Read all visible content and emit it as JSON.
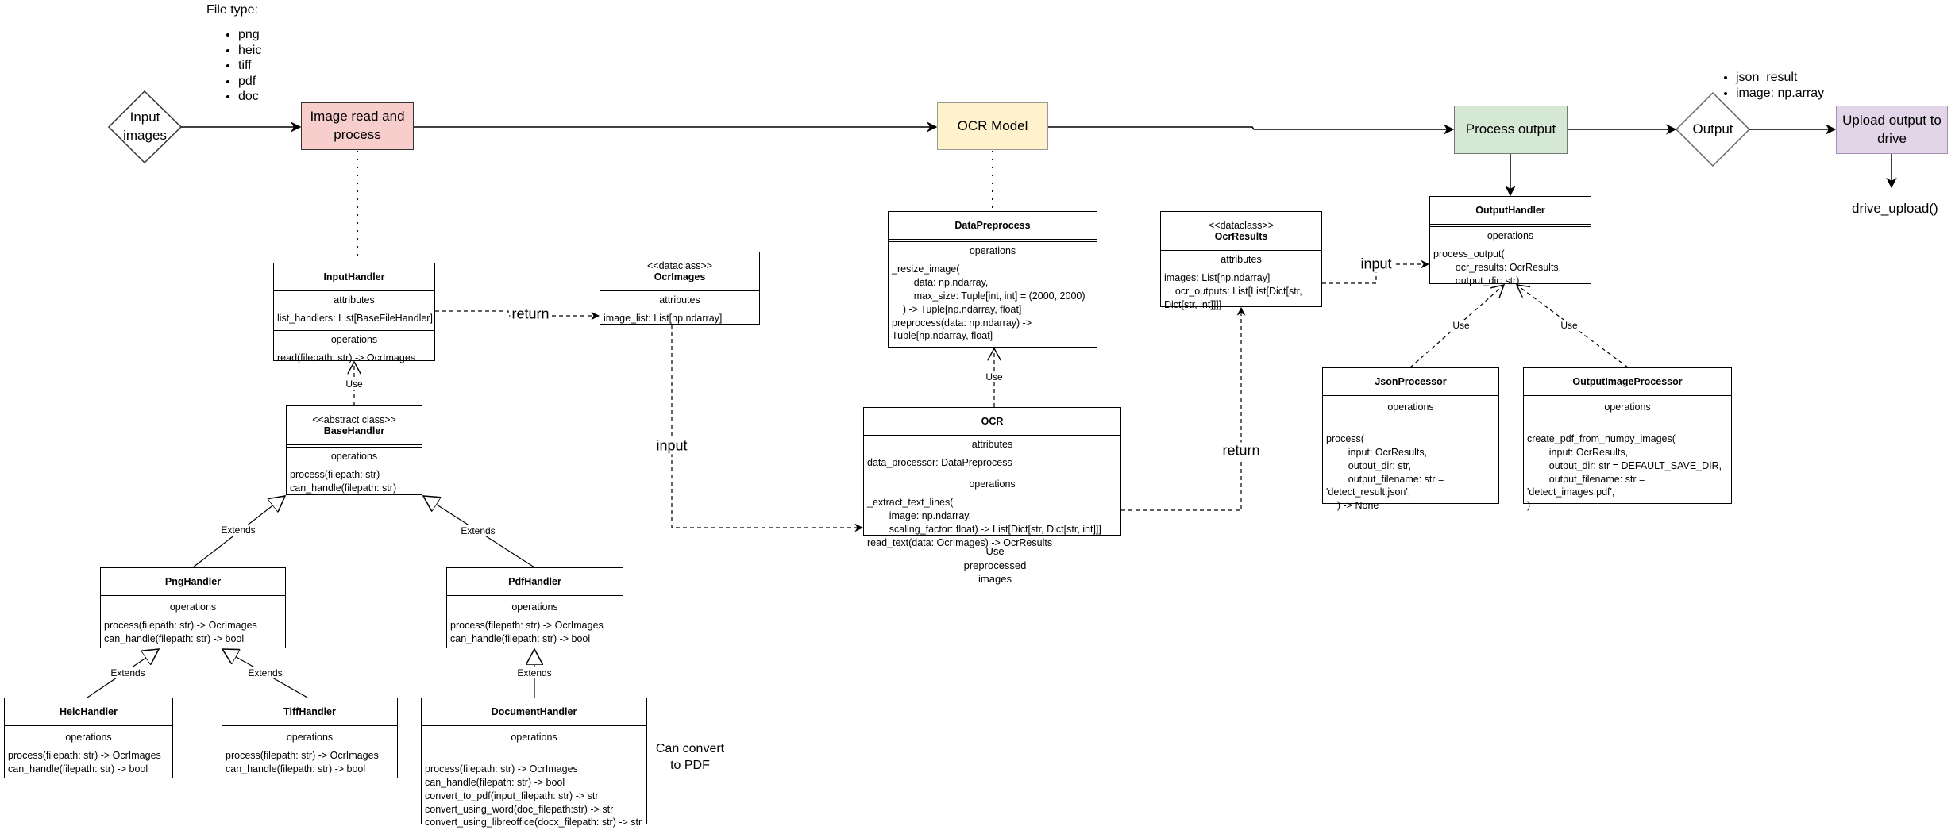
{
  "file_types": {
    "title": "File type:",
    "items": [
      "png",
      "heic",
      "tiff",
      "pdf",
      "doc"
    ]
  },
  "flow": {
    "input_images": "Input images",
    "image_read": "Image read and process",
    "ocr_model": "OCR Model",
    "process_output": "Process output",
    "output": "Output",
    "upload": "Upload output to drive",
    "drive_upload": "drive_upload()",
    "output_items": [
      "json_result",
      "image: np.array"
    ]
  },
  "colors": {
    "image_read": "#f8cecc",
    "ocr_model": "#fff2cc",
    "process_output": "#d5e8d4",
    "upload": "#e1d5e7"
  },
  "edge_labels": {
    "return_ocrimages": "return",
    "input_ocr": "input",
    "return_ocrresults": "return",
    "input_outputhandler": "input",
    "use_inputhandler": "Use",
    "use_datapreprocess": "Use",
    "use_json": "Use",
    "use_outputimage": "Use",
    "extends_png": "Extends",
    "extends_pdf": "Extends",
    "extends_heic": "Extends",
    "extends_tiff": "Extends",
    "extends_document": "Extends"
  },
  "notes": {
    "use_preprocessed": "Use\npreprocessed\nimages",
    "can_convert": "Can convert\nto PDF"
  },
  "classes": [
    {
      "name": "InputHandler",
      "stereotype": "",
      "attributes": {
        "title": "attributes",
        "lines": [
          "list_handlers: List[BaseFileHandler]"
        ]
      },
      "operations": {
        "title": "operations",
        "lines": [
          "read(filepath: str) -> OcrImages"
        ]
      }
    },
    {
      "name": "OcrImages",
      "stereotype": "<<dataclass>>",
      "attributes": {
        "title": "attributes",
        "lines": [
          "image_list: List[np.ndarray]"
        ]
      }
    },
    {
      "name": "BaseHandler",
      "stereotype": "<<abstract class>>",
      "operations": {
        "title": "operations",
        "lines": [
          "process(filepath: str)",
          "can_handle(filepath: str)"
        ]
      }
    },
    {
      "name": "PngHandler",
      "stereotype": "",
      "operations": {
        "title": "operations",
        "lines": [
          "process(filepath: str) -> OcrImages",
          "can_handle(filepath: str) -> bool"
        ]
      }
    },
    {
      "name": "PdfHandler",
      "stereotype": "",
      "operations": {
        "title": "operations",
        "lines": [
          "process(filepath: str) -> OcrImages",
          "can_handle(filepath: str) -> bool"
        ]
      }
    },
    {
      "name": "HeicHandler",
      "stereotype": "",
      "operations": {
        "title": "operations",
        "lines": [
          "process(filepath: str) -> OcrImages",
          "can_handle(filepath: str) -> bool"
        ]
      }
    },
    {
      "name": "TiffHandler",
      "stereotype": "",
      "operations": {
        "title": "operations",
        "lines": [
          "process(filepath: str) -> OcrImages",
          "can_handle(filepath: str) -> bool"
        ]
      }
    },
    {
      "name": "DocumentHandler",
      "stereotype": "",
      "operations": {
        "title": "operations",
        "lines": [
          "",
          "process(filepath: str) -> OcrImages",
          "can_handle(filepath: str) -> bool",
          "convert_to_pdf(input_filepath: str) -> str",
          "convert_using_word(doc_filepath:str) -> str",
          "convert_using_libreoffice(docx_filepath: str) -> str"
        ]
      }
    },
    {
      "name": "DataPreprocess",
      "stereotype": "",
      "operations": {
        "title": "operations",
        "lines": [
          "_resize_image(",
          "        data: np.ndarray,",
          "        max_size: Tuple[int, int] = (2000, 2000)",
          "    ) -> Tuple[np.ndarray, float]",
          "preprocess(data: np.ndarray) ->",
          "Tuple[np.ndarray, float]"
        ]
      }
    },
    {
      "name": "OCR",
      "stereotype": "",
      "attributes": {
        "title": "attributes",
        "lines": [
          "data_processor: DataPreprocess"
        ]
      },
      "operations": {
        "title": "operations",
        "lines": [
          "_extract_text_lines(",
          "        image: np.ndarray,",
          "        scaling_factor: float) -> List[Dict[str, Dict[str, int]]]",
          "read_text(data: OcrImages) -> OcrResults"
        ]
      }
    },
    {
      "name": "OcrResults",
      "stereotype": "<<dataclass>>",
      "attributes": {
        "title": "attributes",
        "lines": [
          "images: List[np.ndarray]",
          "    ocr_outputs: List[List[Dict[str,",
          "Dict[str, int]]]]"
        ]
      }
    },
    {
      "name": "OutputHandler",
      "stereotype": "",
      "operations": {
        "title": "operations",
        "lines": [
          "process_output(",
          "        ocr_results: OcrResults,",
          "        output_dir: str)"
        ]
      }
    },
    {
      "name": "JsonProcessor",
      "stereotype": "",
      "operations": {
        "title": "operations",
        "lines": [
          "",
          "process(",
          "        input: OcrResults,",
          "        output_dir: str,",
          "        output_filename: str =",
          "'detect_result.json',",
          "    ) -> None"
        ]
      }
    },
    {
      "name": "OutputImageProcessor",
      "stereotype": "",
      "operations": {
        "title": "operations",
        "lines": [
          "",
          "create_pdf_from_numpy_images(",
          "        input: OcrResults,",
          "        output_dir: str = DEFAULT_SAVE_DIR,",
          "        output_filename: str =",
          "'detect_images.pdf',",
          ")"
        ]
      }
    }
  ]
}
